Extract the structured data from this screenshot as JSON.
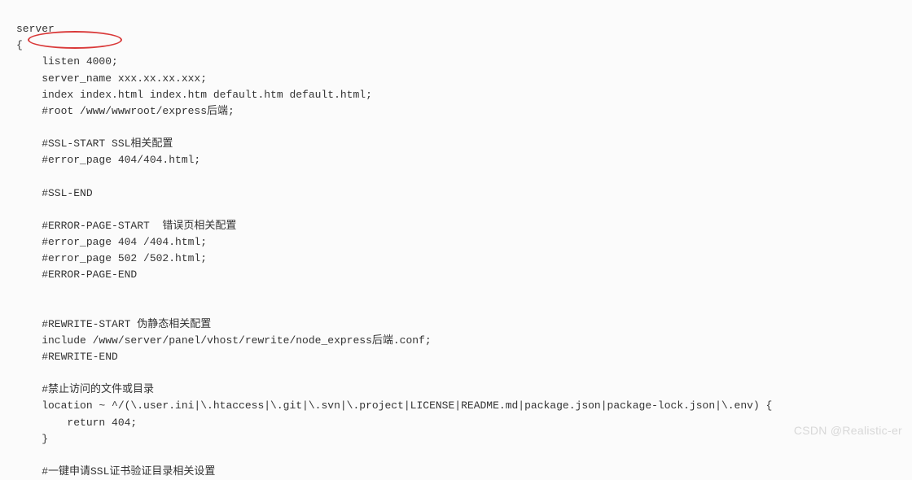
{
  "code": {
    "l1": "server",
    "l2": "{",
    "l3": "    listen 4000;",
    "l4": "    server_name xxx.xx.xx.xxx;",
    "l5": "    index index.html index.htm default.htm default.html;",
    "l6": "    #root /www/wwwroot/express后端;",
    "l7": "",
    "l8": "    #SSL-START SSL相关配置",
    "l9": "    #error_page 404/404.html;",
    "l10": "",
    "l11": "    #SSL-END",
    "l12": "",
    "l13": "    #ERROR-PAGE-START  错误页相关配置",
    "l14": "    #error_page 404 /404.html;",
    "l15": "    #error_page 502 /502.html;",
    "l16": "    #ERROR-PAGE-END",
    "l17": "",
    "l18": "",
    "l19": "    #REWRITE-START 伪静态相关配置",
    "l20": "    include /www/server/panel/vhost/rewrite/node_express后端.conf;",
    "l21": "    #REWRITE-END",
    "l22": "",
    "l23": "    #禁止访问的文件或目录",
    "l24": "    location ~ ^/(\\.user.ini|\\.htaccess|\\.git|\\.svn|\\.project|LICENSE|README.md|package.json|package-lock.json|\\.env) {",
    "l25": "        return 404;",
    "l26": "    }",
    "l27": "",
    "l28": "    #一键申请SSL证书验证目录相关设置"
  },
  "annotation": {
    "highlighted_text": "listen 4000;"
  },
  "watermark": "CSDN @Realistic-er"
}
